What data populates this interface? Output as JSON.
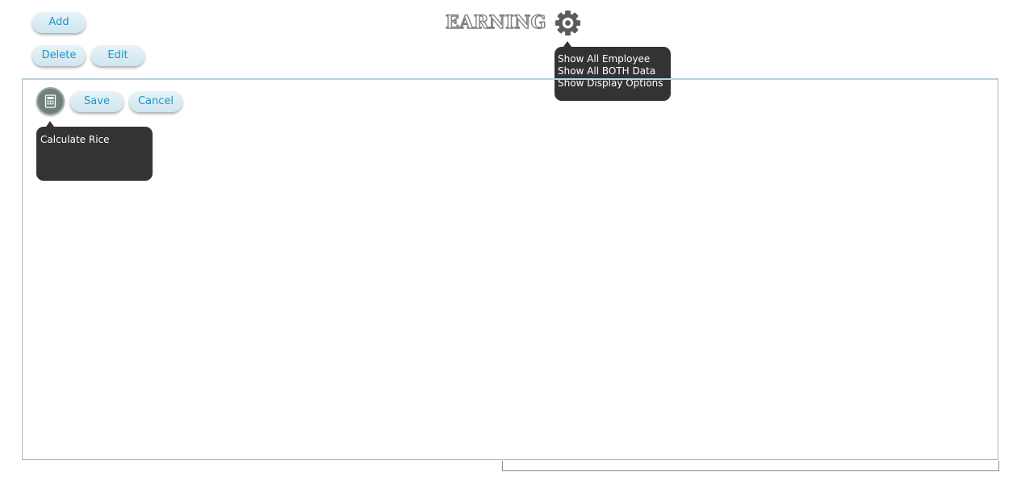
{
  "header": {
    "title": "EARNING",
    "add_label": "Add",
    "delete_label": "Delete",
    "edit_label": "Edit"
  },
  "settings_menu": {
    "icon": "gear-icon",
    "items": [
      {
        "label": "Show All Employee"
      },
      {
        "label": "Show All BOTH Data"
      },
      {
        "label": "Show Display Options"
      }
    ]
  },
  "panel": {
    "calculator_icon": "calculator-icon",
    "save_label": "Save",
    "cancel_label": "Cancel",
    "calc_tooltip": "Calculate Rice"
  },
  "colors": {
    "button_text": "#1f95c9",
    "button_bg": "#d8ecf3",
    "tooltip_bg": "#333333",
    "panel_border": "#a9b8c3"
  }
}
